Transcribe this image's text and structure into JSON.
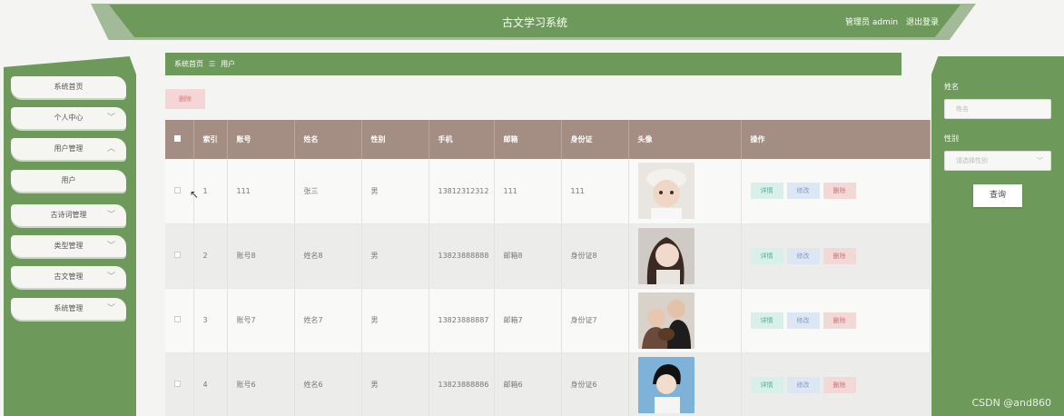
{
  "header": {
    "title": "古文学习系统",
    "user": "管理员 admin",
    "logout": "退出登录"
  },
  "sidebar": {
    "items": [
      {
        "label": "系统首页",
        "chev": ""
      },
      {
        "label": "个人中心",
        "chev": "﹀"
      },
      {
        "label": "用户管理",
        "chev": "︿"
      },
      {
        "label": "用户",
        "chev": ""
      },
      {
        "label": "古诗词管理",
        "chev": "﹀"
      },
      {
        "label": "类型管理",
        "chev": "﹀"
      },
      {
        "label": "古文管理",
        "chev": "﹀"
      },
      {
        "label": "系统管理",
        "chev": "﹀"
      }
    ]
  },
  "breadcrumb": {
    "home": "系统首页",
    "sep": "☰",
    "current": "用户"
  },
  "toolbar": {
    "delete_label": "删除"
  },
  "table": {
    "headers": [
      "",
      "索引",
      "账号",
      "姓名",
      "性别",
      "手机",
      "邮箱",
      "身份证",
      "头像",
      "操作"
    ],
    "rows": [
      {
        "index": "1",
        "account": "111",
        "name": "张三",
        "gender": "男",
        "phone": "13812312312",
        "email": "111",
        "idcard": "111"
      },
      {
        "index": "2",
        "account": "账号8",
        "name": "姓名8",
        "gender": "男",
        "phone": "13823888888",
        "email": "邮箱8",
        "idcard": "身份证8"
      },
      {
        "index": "3",
        "account": "账号7",
        "name": "姓名7",
        "gender": "男",
        "phone": "13823888887",
        "email": "邮箱7",
        "idcard": "身份证7"
      },
      {
        "index": "4",
        "account": "账号6",
        "name": "姓名6",
        "gender": "男",
        "phone": "13823888886",
        "email": "邮箱6",
        "idcard": "身份证6"
      }
    ],
    "ops": {
      "detail": "详情",
      "edit": "修改",
      "remove": "删除"
    }
  },
  "search": {
    "name_label": "姓名",
    "name_placeholder": "姓名",
    "gender_label": "性别",
    "gender_placeholder": "请选择性别",
    "button": "查询"
  },
  "watermark": "CSDN @and860",
  "colors": {
    "accent": "#6d9a5a",
    "table_header": "#a48d82"
  }
}
